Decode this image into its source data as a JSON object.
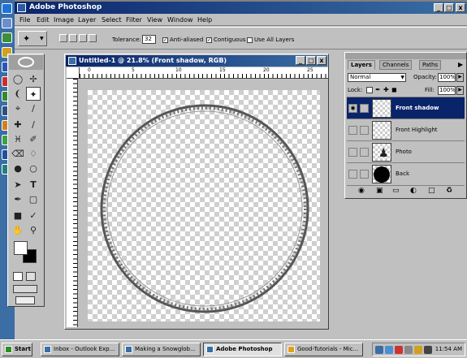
{
  "window": {
    "title": "Adobe Photoshop"
  },
  "menu": [
    "File",
    "Edit",
    "Image",
    "Layer",
    "Select",
    "Filter",
    "View",
    "Window",
    "Help"
  ],
  "options": {
    "tolerance_label": "Tolerance:",
    "tolerance_value": "32",
    "anti_aliased": "Anti-aliased",
    "contiguous": "Contiguous",
    "use_all_layers": "Use All Layers"
  },
  "document": {
    "title": "Untitled-1 @ 21.8% (Front shadow, RGB)",
    "ruler_ticks": [
      "0",
      "5",
      "10",
      "15",
      "20",
      "25"
    ]
  },
  "layers_palette": {
    "tabs": [
      "Layers",
      "Channels",
      "Paths"
    ],
    "blend_mode": "Normal",
    "opacity_label": "Opacity:",
    "opacity_value": "100%",
    "lock_label": "Lock:",
    "fill_label": "Fill:",
    "fill_value": "100%",
    "layers": [
      {
        "name": "Front shadow",
        "selected": true
      },
      {
        "name": "Front Highlight",
        "selected": false
      },
      {
        "name": "Photo",
        "selected": false
      },
      {
        "name": "Back",
        "selected": false
      }
    ]
  },
  "taskbar": {
    "start": "Start",
    "buttons": [
      {
        "label": "Inbox - Outlook Exp..."
      },
      {
        "label": "Making a Snowglob..."
      },
      {
        "label": "Adobe Photoshop"
      },
      {
        "label": "Good-Tutorials - Mic..."
      }
    ],
    "clock": "11:54 AM"
  },
  "colors": {
    "titlebar": "#0a246a",
    "chrome": "#c0c0c0",
    "selected_layer": "#0a246a"
  }
}
